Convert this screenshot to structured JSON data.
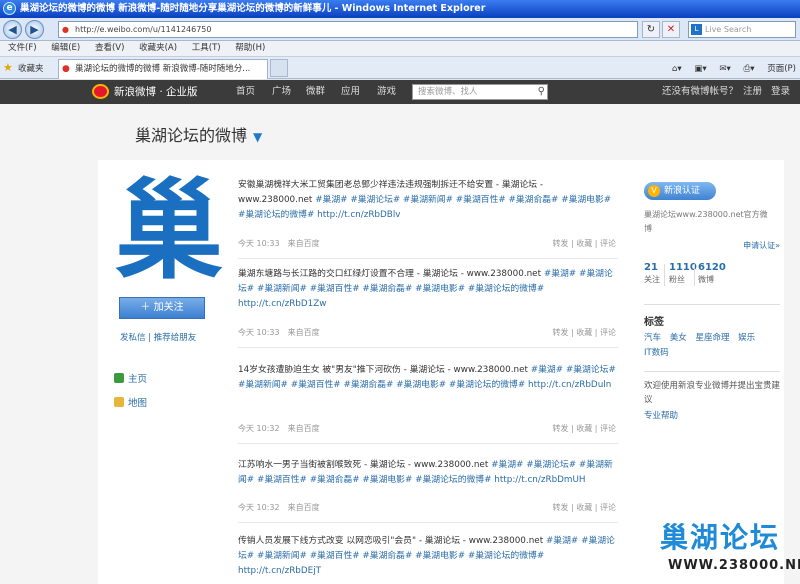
{
  "window": {
    "title": "巢湖论坛的微博的微博 新浪微博-随时随地分享巢湖论坛的微博的新鲜事儿 - Windows Internet Explorer"
  },
  "address": {
    "url": "http://e.weibo.com/u/1141246750",
    "search_placeholder": "Live Search"
  },
  "menu": {
    "items": [
      "文件(F)",
      "编辑(E)",
      "查看(V)",
      "收藏夹(A)",
      "工具(T)",
      "帮助(H)"
    ]
  },
  "favbar": {
    "favorites_label": "收藏夹",
    "tab_title": "巢湖论坛的微博的微博 新浪微博-随时随地分...",
    "page_menu": "页面(P)",
    "tools_menu": "工具(O)"
  },
  "sina_nav": {
    "logo": "新浪微博 · 企业版",
    "links": [
      "首页",
      "广场",
      "微群",
      "应用",
      "游戏"
    ],
    "search_placeholder": "搜索微博、找人",
    "no_account": "还没有微博帐号？",
    "register": "注册",
    "login": "登录"
  },
  "profile": {
    "name": "巢湖论坛的微博",
    "avatar_text": "巢",
    "follow_button": "加关注",
    "send_message": "发私信",
    "recommend": "推荐给朋友",
    "nav": [
      {
        "label": "主页"
      },
      {
        "label": "地图"
      }
    ]
  },
  "posts": [
    {
      "text": "安徽巢湖槐祥大米工贸集团老总鄧少祥违法违规强制拆迁不给安置 - 巢湖论坛 - www.238000.net",
      "tags": "#巢湖# #巢湖论坛# #巢湖新闻# #巢湖百性# #巢湖俞磊# #巢湖电影# #巢湖论坛的微博#",
      "link": "http://t.cn/zRbDBlv",
      "time": "今天 10:33",
      "source": "来自百度",
      "actions": "转发 | 收藏 | 评论"
    },
    {
      "text": "巢湖东塘路与长江路的交口红绿灯设置不合理 - 巢湖论坛 - www.238000.net",
      "tags": "#巢湖# #巢湖论坛# #巢湖新闻# #巢湖百性# #巢湖俞磊# #巢湖电影# #巢湖论坛的微博#",
      "link": "http://t.cn/zRbD1Zw",
      "time": "今天 10:33",
      "source": "来自百度",
      "actions": "转发 | 收藏 | 评论"
    },
    {
      "text": "14岁女孩遭胁迫生女 被\"男友\"推下河砍伤 - 巢湖论坛 - www.238000.net",
      "tags": "#巢湖# #巢湖论坛# #巢湖新闻# #巢湖百性# #巢湖俞磊# #巢湖电影# #巢湖论坛的微博#",
      "link": "http://t.cn/zRbDuln",
      "time": "今天 10:32",
      "source": "来自百度",
      "actions": "转发 | 收藏 | 评论"
    },
    {
      "text": "江苏响水一男子当街被割喉致死 - 巢湖论坛 - www.238000.net",
      "tags": "#巢湖# #巢湖论坛# #巢湖新闻# #巢湖百性# #巢湖俞磊# #巢湖电影# #巢湖论坛的微博#",
      "link": "http://t.cn/zRbDmUH",
      "time": "今天 10:32",
      "source": "来自百度",
      "actions": "转发 | 收藏 | 评论"
    },
    {
      "text": "传销人员发展下线方式改变 以网恋吸引\"会员\" - 巢湖论坛 - www.238000.net",
      "tags": "#巢湖# #巢湖论坛# #巢湖新闻# #巢湖百性# #巢湖俞磊# #巢湖电影# #巢湖论坛的微博#",
      "link": "http://t.cn/zRbDEjT",
      "time": "",
      "source": "",
      "actions": ""
    }
  ],
  "sidebar": {
    "verify_label": "新浪认证",
    "description": "巢湖论坛www.238000.net官方微博",
    "apply": "申请认证»",
    "stats": [
      {
        "value": "21",
        "label": "关注"
      },
      {
        "value": "1110",
        "label": "粉丝"
      },
      {
        "value": "6120",
        "label": "微博"
      }
    ],
    "tags_title": "标签",
    "tags": [
      "汽车",
      "美女",
      "星座命理",
      "娱乐",
      "IT数码"
    ],
    "welcome": "欢迎使用新浪专业微博并提出宝贵建议",
    "help": "专业帮助"
  },
  "watermark": {
    "text": "巢湖论坛",
    "url": "WWW.238000.NET"
  },
  "colors": {
    "link": "#2a6da8",
    "accent": "#1f7bc9",
    "nav_bg": "#3b3b3b"
  }
}
